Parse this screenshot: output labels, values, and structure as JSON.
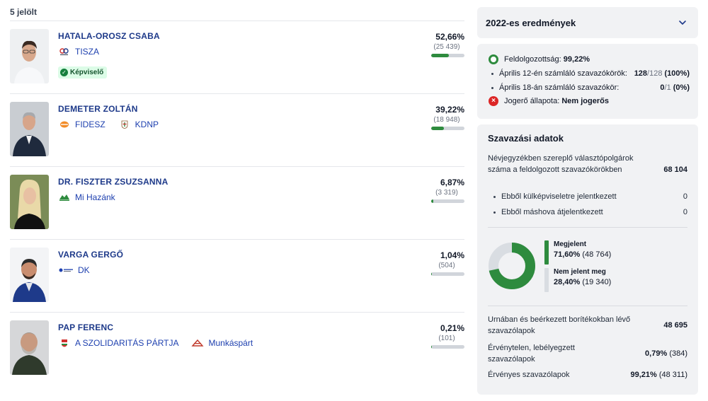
{
  "candidate_count": "5 jelölt",
  "candidates": [
    {
      "name": "HATALA-OROSZ CSABA",
      "parties": [
        {
          "name": "TISZA",
          "logo": "tisza-logo"
        }
      ],
      "badge": "Képviselő",
      "percent": "52,66%",
      "votes": "(25 439)",
      "share": 0.5266
    },
    {
      "name": "DEMETER ZOLTÁN",
      "parties": [
        {
          "name": "FIDESZ",
          "logo": "fidesz-logo"
        },
        {
          "name": "KDNP",
          "logo": "kdnp-logo"
        }
      ],
      "percent": "39,22%",
      "votes": "(18 948)",
      "share": 0.3922
    },
    {
      "name": "DR. FISZTER ZSUZSANNA",
      "parties": [
        {
          "name": "Mi Hazánk",
          "logo": "mi-hazank-logo"
        }
      ],
      "percent": "6,87%",
      "votes": "(3 319)",
      "share": 0.0687
    },
    {
      "name": "VARGA GERGŐ",
      "parties": [
        {
          "name": "DK",
          "logo": "dk-logo"
        }
      ],
      "percent": "1,04%",
      "votes": "(504)",
      "share": 0.0104
    },
    {
      "name": "PAP FERENC",
      "parties": [
        {
          "name": "A SZOLIDARITÁS PÁRTJA",
          "logo": "szolidaritas-logo"
        },
        {
          "name": "Munkáspárt",
          "logo": "munkaspart-logo"
        }
      ],
      "percent": "0,21%",
      "votes": "(101)",
      "share": 0.0021
    }
  ],
  "results_panel": {
    "title": "2022-es eredmények",
    "icon": "chevron-down-icon"
  },
  "status": {
    "processed_label": "Feldolgozottság:",
    "processed_value": "99,22%",
    "apr12_label": "Április 12-én számláló szavazókörök:",
    "apr12_count": "128",
    "apr12_total": "/128",
    "apr12_pct": "(100%)",
    "apr18_label": "Április 18-án számláló szavazókör:",
    "apr18_count": "0",
    "apr18_total": "/1",
    "apr18_pct": "(0%)",
    "legal_label": "Jogerő állapota:",
    "legal_value": "Nem jogerős"
  },
  "voting": {
    "title": "Szavazási adatok",
    "registered_label": "Névjegyzékben szereplő választópolgárok száma a feldolgozott szavazókörökben",
    "registered_value": "68 104",
    "abroad_label": "Ebből külképviseletre jelentkezett",
    "abroad_value": "0",
    "elsewhere_label": "Ebből máshova átjelentkezett",
    "elsewhere_value": "0",
    "turnout_label": "Megjelent",
    "turnout_pct": "71,60%",
    "turnout_count": "(48 764)",
    "turnout_share": 0.716,
    "absent_label": "Nem jelent meg",
    "absent_pct": "28,40%",
    "absent_count": "(19 340)",
    "ballots_label": "Urnában és beérkezett borítékokban lévő szavazólapok",
    "ballots_value": "48 695",
    "invalid_label": "Érvénytelen, lebélyegzett szavazólapok",
    "invalid_pct": "0,79%",
    "invalid_count": "(384)",
    "valid_label": "Érvényes szavazólapok",
    "valid_pct": "99,21%",
    "valid_count": "(48 311)"
  },
  "colors": {
    "accent_green": "#2e8b3e",
    "name_blue": "#1e3a8a",
    "panel_bg": "#f1f2f4",
    "badge_bg": "#dcfce7",
    "error_red": "#dc2626"
  }
}
